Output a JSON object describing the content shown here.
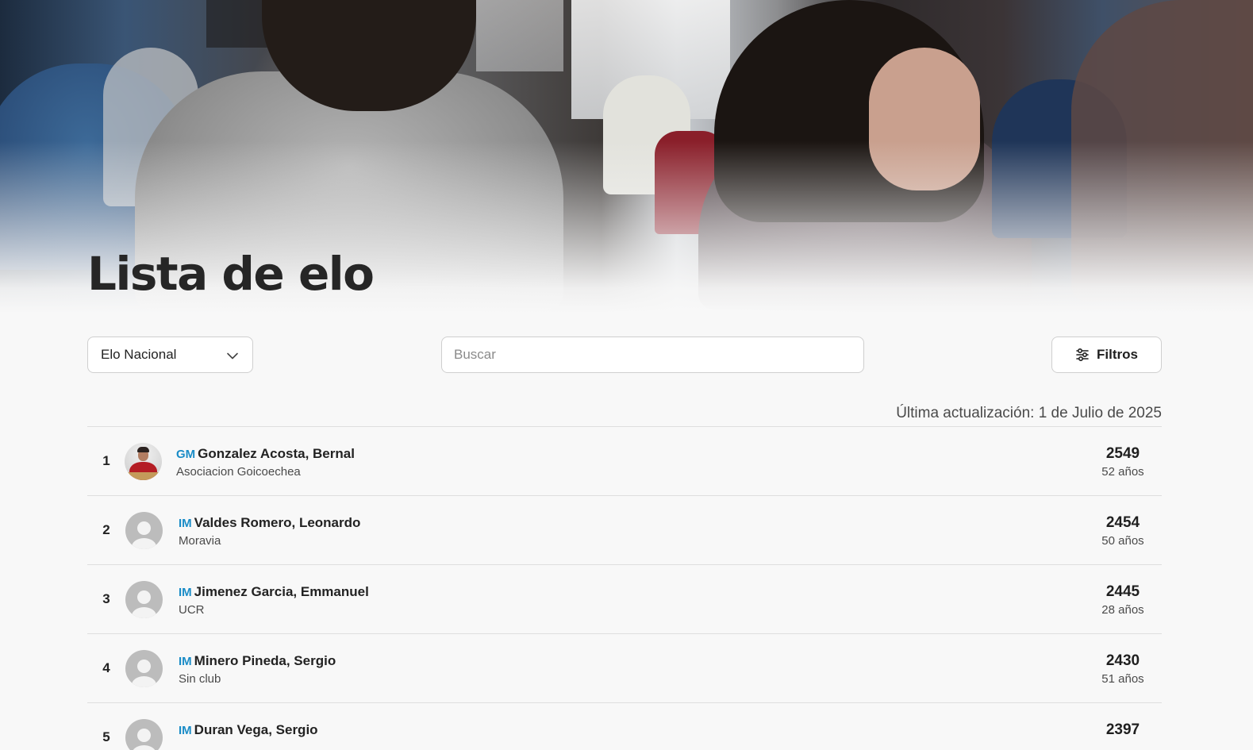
{
  "page": {
    "title": "Lista de elo"
  },
  "controls": {
    "rating_type_selected": "Elo Nacional",
    "search_placeholder": "Buscar",
    "filters_label": "Filtros"
  },
  "last_updated": "Última actualización: 1 de Julio de 2025",
  "players": [
    {
      "rank": "1",
      "title": "GM",
      "name": "Gonzalez Acosta, Bernal",
      "club": "Asociacion Goicoechea",
      "rating": "2549",
      "age": "52 años",
      "avatar": "photo"
    },
    {
      "rank": "2",
      "title": "IM",
      "name": "Valdes Romero, Leonardo",
      "club": "Moravia",
      "rating": "2454",
      "age": "50 años",
      "avatar": "default"
    },
    {
      "rank": "3",
      "title": "IM",
      "name": "Jimenez Garcia, Emmanuel",
      "club": "UCR",
      "rating": "2445",
      "age": "28 años",
      "avatar": "default"
    },
    {
      "rank": "4",
      "title": "IM",
      "name": "Minero Pineda, Sergio",
      "club": "Sin club",
      "rating": "2430",
      "age": "51 años",
      "avatar": "default"
    },
    {
      "rank": "5",
      "title": "IM",
      "name": "Duran Vega, Sergio",
      "club": "",
      "rating": "2397",
      "age": "",
      "avatar": "default"
    }
  ],
  "icons": {
    "select_chevron": "chevron-down-icon",
    "filter": "sliders-icon",
    "avatar_default": "user-placeholder-icon"
  },
  "colors": {
    "title_badge": "#1a8cc7",
    "background": "#f8f8f8"
  }
}
